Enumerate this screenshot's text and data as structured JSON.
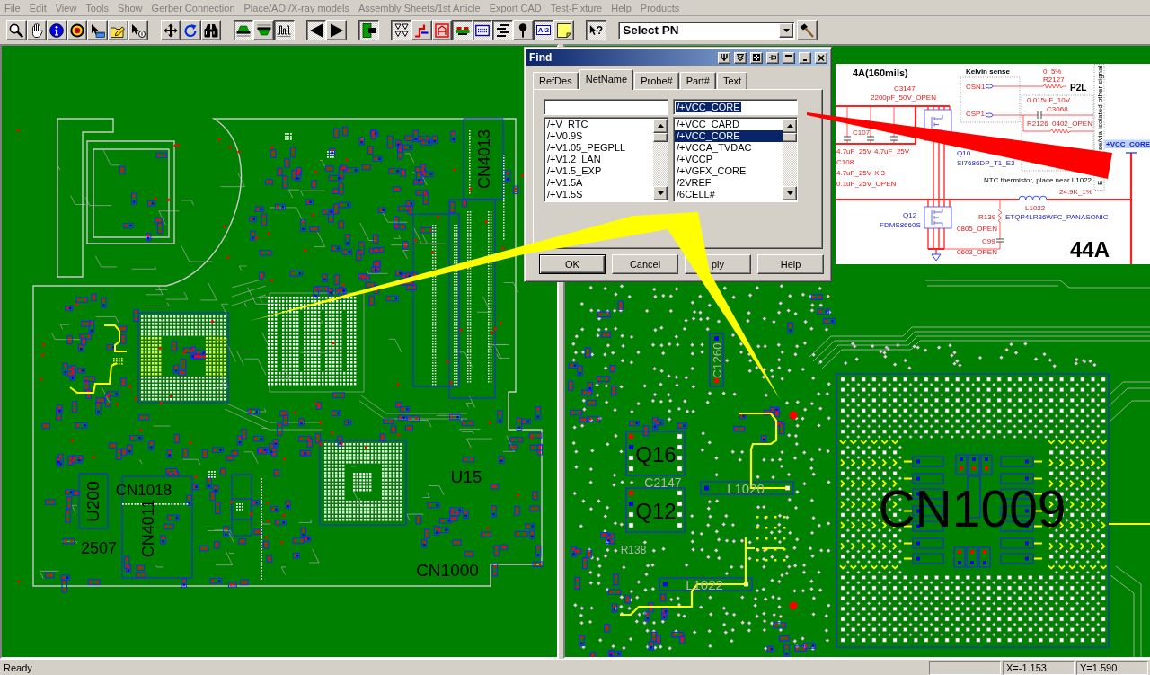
{
  "menu_bar": [
    {
      "label": "File",
      "disabled": true
    },
    {
      "label": "Edit",
      "disabled": true
    },
    {
      "label": "View",
      "disabled": true
    },
    {
      "label": "Tools",
      "disabled": true
    },
    {
      "label": "Show",
      "disabled": true
    },
    {
      "label": "Gerber Connection",
      "disabled": true
    },
    {
      "label": "Place/AOI/X-ray models",
      "disabled": true
    },
    {
      "label": "Assembly Sheets/1st Article",
      "disabled": true
    },
    {
      "label": "Export CAD",
      "disabled": true
    },
    {
      "label": "Test-Fixture",
      "disabled": true
    },
    {
      "label": "Help",
      "disabled": true
    },
    {
      "label": "Products",
      "disabled": true
    }
  ],
  "toolbar": {
    "groups": [
      [
        {
          "on": false
        },
        {
          "on": false
        },
        {
          "on": false
        },
        {
          "on": false
        },
        {
          "on": false
        },
        {
          "on": false
        },
        {
          "on": false
        }
      ],
      [
        {
          "on": false
        },
        {
          "on": false
        },
        {
          "on": false
        }
      ],
      [
        {
          "on": true
        },
        {
          "on": false
        },
        {
          "on": true
        }
      ],
      [
        {
          "on": true
        },
        {
          "on": false
        }
      ],
      [
        {
          "on": true
        }
      ],
      [
        {
          "on": true
        },
        {
          "on": false
        },
        {
          "on": false
        },
        {
          "on": true
        },
        {
          "on": true
        },
        {
          "on": true
        },
        {
          "on": false
        },
        {
          "label": "AI2",
          "on": true
        },
        {
          "on": false
        }
      ],
      [
        {
          "label": "?",
          "on": true
        }
      ]
    ],
    "part_selector": {
      "value": "Select PN"
    }
  },
  "board_view": {
    "labels": [
      {
        "text": "CN4013"
      },
      {
        "text": "U200"
      },
      {
        "text": "CN1018"
      },
      {
        "text": "U15"
      },
      {
        "text": "2507"
      },
      {
        "text": "CN4011"
      },
      {
        "text": "CN1000"
      }
    ]
  },
  "detail_view": {
    "labels": [
      {
        "text": "Q16",
        "kind": "part"
      },
      {
        "text": "Q12",
        "kind": "part"
      },
      {
        "text": "CN1009",
        "kind": "part"
      },
      {
        "text": "C1260",
        "kind": "refdes"
      },
      {
        "text": "L1020",
        "kind": "refdes"
      },
      {
        "text": "L1022",
        "kind": "refdes"
      },
      {
        "text": "C2147",
        "kind": "refdes"
      },
      {
        "text": "R138",
        "kind": "refdes"
      }
    ]
  },
  "find_dialog": {
    "title": "Find",
    "tabs": [
      {
        "label": "RefDes",
        "selected": false
      },
      {
        "label": "NetName",
        "selected": true
      },
      {
        "label": "Probe#",
        "selected": false
      },
      {
        "label": "Part#",
        "selected": false
      },
      {
        "label": "Text",
        "selected": false
      }
    ],
    "columns": [
      {
        "items": [
          {
            "label": "/+V_RTC",
            "selected": false
          },
          {
            "label": "/+V0.9S",
            "selected": false
          },
          {
            "label": "/+V1.05_PEGPLL",
            "selected": false
          },
          {
            "label": "/+V1.2_LAN",
            "selected": false
          },
          {
            "label": "/+V1.5_EXP",
            "selected": false
          },
          {
            "label": "/+V1.5A",
            "selected": false
          },
          {
            "label": "/+V1.5S",
            "selected": false
          }
        ]
      },
      {
        "field_value": "/+VCC_CORE",
        "field_highlighted": true,
        "items": [
          {
            "label": "/+VCC_CARD",
            "selected": false
          },
          {
            "label": "/+VCC_CORE",
            "selected": true
          },
          {
            "label": "/+VCCA_TVDAC",
            "selected": false
          },
          {
            "label": "/+VCCP",
            "selected": false
          },
          {
            "label": "/+VGFX_CORE",
            "selected": false
          },
          {
            "label": "/2VREF",
            "selected": false
          },
          {
            "label": "/6CELL#",
            "selected": false
          }
        ]
      }
    ],
    "buttons": [
      {
        "label": "OK",
        "default": true
      },
      {
        "label": "Cancel",
        "default": false
      },
      {
        "label": "ply",
        "default": false
      },
      {
        "label": "Help",
        "default": false
      }
    ]
  },
  "schematic_inset": {
    "labels": [
      {
        "text": "4A(160mils)",
        "kind": "annotation"
      },
      {
        "text": "Kelvin sense",
        "kind": "annotation"
      },
      {
        "text": "0_5%",
        "kind": "value"
      },
      {
        "text": "se/via isolated other signal",
        "kind": "note"
      },
      {
        "text": "R2127",
        "kind": "designator"
      },
      {
        "text": "C3147",
        "kind": "designator"
      },
      {
        "text": "CSN1",
        "kind": "designator"
      },
      {
        "text": "P2L",
        "kind": "annotation"
      },
      {
        "text": "2200pF_50V_OPEN",
        "kind": "value"
      },
      {
        "text": "0.015uF_10V",
        "kind": "value"
      },
      {
        "text": "CSP1",
        "kind": "designator"
      },
      {
        "text": "C3068",
        "kind": "designator"
      },
      {
        "text": "R2126",
        "kind": "designator"
      },
      {
        "text": "0402_OPEN",
        "kind": "value"
      },
      {
        "text": "C107",
        "kind": "designator"
      },
      {
        "text": "4.7uF_25V",
        "kind": "value"
      },
      {
        "text": "4.7uF_25V",
        "kind": "value"
      },
      {
        "text": "Q10",
        "kind": "device"
      },
      {
        "text": "C108",
        "kind": "designator"
      },
      {
        "text": "SI7686DP_T1_E3",
        "kind": "device"
      },
      {
        "text": "4.7uF_25V",
        "kind": "value"
      },
      {
        "text": "X 3",
        "kind": "value"
      },
      {
        "text": "NTC thermistor, place near L1022",
        "kind": "note"
      },
      {
        "text": "0.1uF_25V_OPEN",
        "kind": "value"
      },
      {
        "text": "E",
        "kind": "note"
      },
      {
        "text": "24.9K_1%",
        "kind": "value"
      },
      {
        "text": "L1022",
        "kind": "designator"
      },
      {
        "text": "Q12",
        "kind": "device"
      },
      {
        "text": "R139",
        "kind": "designator"
      },
      {
        "text": "ETQP4LR36WFC_PANASONIC",
        "kind": "device"
      },
      {
        "text": "FDMS8660S",
        "kind": "device"
      },
      {
        "text": "0805_OPEN",
        "kind": "value"
      },
      {
        "text": "C99",
        "kind": "designator"
      },
      {
        "text": "0603_OPEN",
        "kind": "value"
      },
      {
        "text": "44A",
        "kind": "annotation"
      }
    ],
    "net_flag": {
      "text": "+VCC_CORE",
      "highlighted": true
    }
  },
  "status_bar": {
    "message": "Ready",
    "panels": [
      "X=-1.153",
      "Y=1.590"
    ]
  }
}
